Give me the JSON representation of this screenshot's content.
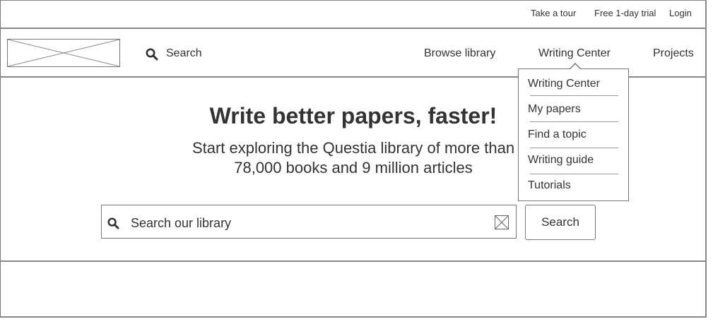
{
  "top_bar": {
    "links": [
      "Take a tour",
      "Free 1-day trial",
      "Login"
    ]
  },
  "header": {
    "search_label": "Search",
    "nav": [
      "Browse library",
      "Writing Center",
      "Projects"
    ]
  },
  "dropdown": {
    "items": [
      "Writing Center",
      "My papers",
      "Find a topic",
      "Writing guide",
      "Tutorials"
    ]
  },
  "hero": {
    "title": "Write better papers, faster!",
    "subtitle_line1": "Start exploring the Questia library of more than",
    "subtitle_line2": "78,000 books and 9 million articles"
  },
  "search": {
    "placeholder": "Search our library",
    "button_label": "Search"
  },
  "icons": {
    "logo": "image-placeholder",
    "nav_search": "search-icon",
    "field_search": "search-icon",
    "clear": "clear-icon"
  },
  "colors": {
    "text": "#333333",
    "border": "#777777",
    "background": "#ffffff"
  }
}
